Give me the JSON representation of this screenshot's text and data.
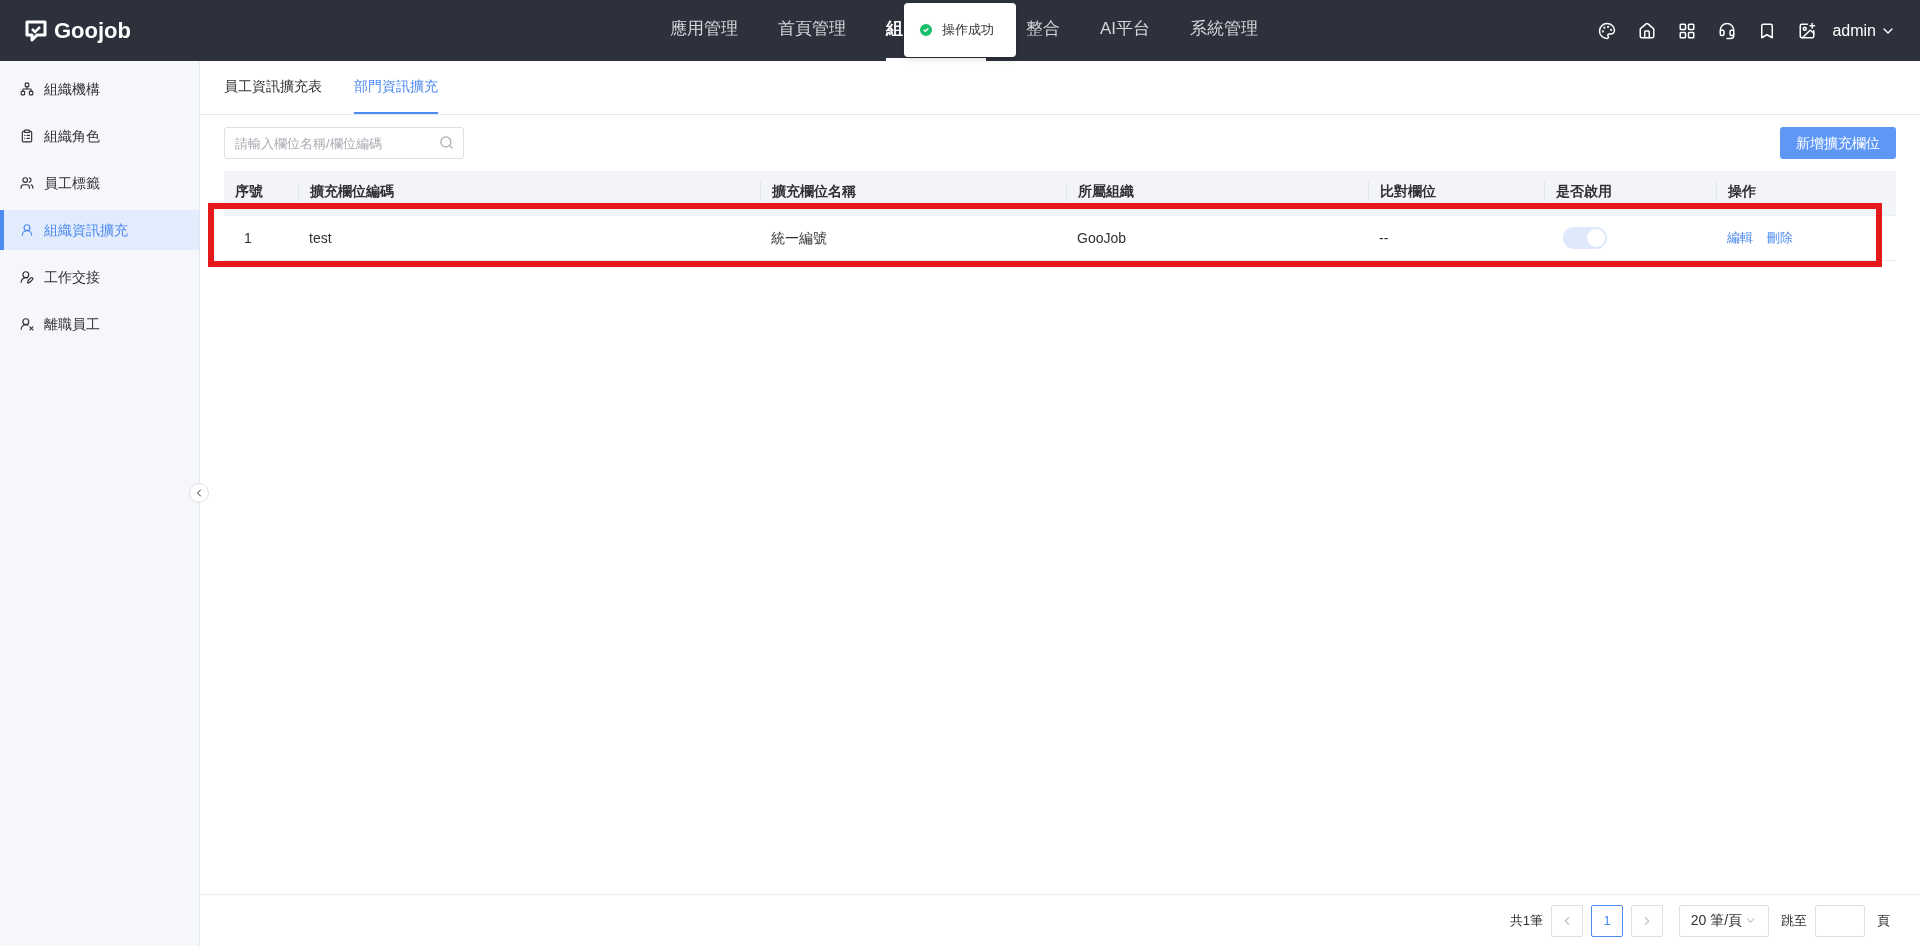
{
  "header": {
    "logo": "Goojob",
    "nav": [
      {
        "label": "應用管理",
        "selected": false
      },
      {
        "label": "首頁管理",
        "selected": false
      },
      {
        "label": "組",
        "selected": true
      },
      {
        "label": "整合",
        "selected": false
      },
      {
        "label": "AI平台",
        "selected": false
      },
      {
        "label": "系統管理",
        "selected": false
      }
    ],
    "user": "admin"
  },
  "toast": {
    "message": "操作成功"
  },
  "sidebar": {
    "items": [
      {
        "label": "組織機構",
        "selected": false
      },
      {
        "label": "組織角色",
        "selected": false
      },
      {
        "label": "員工標籤",
        "selected": false
      },
      {
        "label": "組織資訊擴充",
        "selected": true
      },
      {
        "label": "工作交接",
        "selected": false
      },
      {
        "label": "離職員工",
        "selected": false
      }
    ]
  },
  "tabs": [
    {
      "label": "員工資訊擴充表",
      "selected": false
    },
    {
      "label": "部門資訊擴充",
      "selected": true
    }
  ],
  "search": {
    "placeholder": "請輸入欄位名稱/欄位編碼"
  },
  "add_button": "新增擴充欄位",
  "table": {
    "columns": [
      "序號",
      "擴充欄位編碼",
      "擴充欄位名稱",
      "所屬組織",
      "比對欄位",
      "是否啟用",
      "操作"
    ],
    "rows": [
      {
        "index": "1",
        "code": "test",
        "name": "統一編號",
        "org": "GooJob",
        "compare": "--",
        "enabled": true,
        "disabled": true,
        "actions": [
          "編輯",
          "刪除"
        ]
      }
    ]
  },
  "pagination": {
    "total": "共1筆",
    "pages": [
      {
        "label": "1",
        "selected": true
      }
    ],
    "page_size": "20 筆/頁",
    "jump_label": "跳至",
    "page_suffix": "頁"
  }
}
